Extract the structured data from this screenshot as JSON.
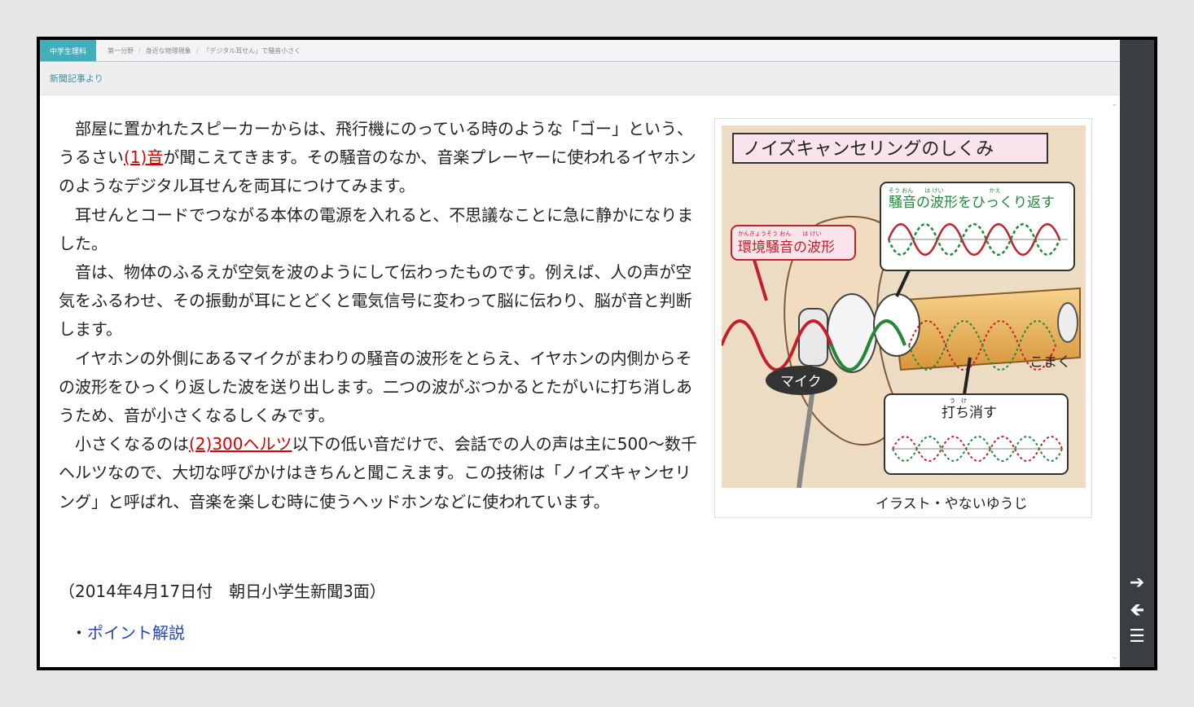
{
  "nav": {
    "subject": "中学生理科",
    "breadcrumbs": [
      "第一分野",
      "身近な物理現象",
      "「デジタル耳せん」で騒音小さく"
    ]
  },
  "subnav": {
    "link": "新聞記事より"
  },
  "article": {
    "p1_a": "部屋に置かれたスピーカーからは、飛行機にのっている時のような「ゴー」という、うるさい",
    "p1_link": "(1)音",
    "p1_b": "が聞こえてきます。その騒音のなか、音楽プレーヤーに使われるイヤホンのようなデジタル耳せんを両耳につけてみます。",
    "p2": "耳せんとコードでつながる本体の電源を入れると、不思議なことに急に静かになりました。",
    "p3": "音は、物体のふるえが空気を波のようにして伝わったものです。例えば、人の声が空気をふるわせ、その振動が耳にとどくと電気信号に変わって脳に伝わり、脳が音と判断します。",
    "p4": "イヤホンの外側にあるマイクがまわりの騒音の波形をとらえ、イヤホンの内側からその波形をひっくり返した波を送り出します。二つの波がぶつかるとたがいに打ち消しあうため、音が小さくなるしくみです。",
    "p5_a": "小さくなるのは",
    "p5_link": "(2)300ヘルツ",
    "p5_b": "以下の低い音だけで、会話での人の声は主に500～数千ヘルツなので、大切な呼びかけはきちんと聞こえます。この技術は「ノイズキャンセリング」と呼ばれ、音楽を楽しむ時に使うヘッドホンなどに使われています。",
    "dateline": "（2014年4月17日付　朝日小学生新聞3面）",
    "point_bullet": "・",
    "point_link": "ポイント解説"
  },
  "figure": {
    "title": "ノイズキャンセリングのしくみ",
    "label_reverse": "騒音の波形をひっくり返す",
    "label_reverse_ruby": "そう おん　　は けい　　　　　　　　かえ",
    "label_env": "環境騒音の波形",
    "label_env_ruby": "かんきょうそう おん　　は けい",
    "label_mic": "マイク",
    "label_eardrum": "こまく",
    "label_cancel": "打ち消す",
    "label_cancel_ruby": "う　け",
    "credit": "イラスト・やないゆうじ"
  },
  "icons": {
    "scroll_up": "chevron-up-icon",
    "scroll_down": "chevron-down-icon",
    "next": "arrow-right-icon",
    "prev": "arrow-left-icon",
    "menu": "menu-icon"
  },
  "colors": {
    "accent": "#41aeb9",
    "link_red": "#d40000",
    "link_blue": "#2545b8",
    "sidebar": "#3a3d42"
  }
}
